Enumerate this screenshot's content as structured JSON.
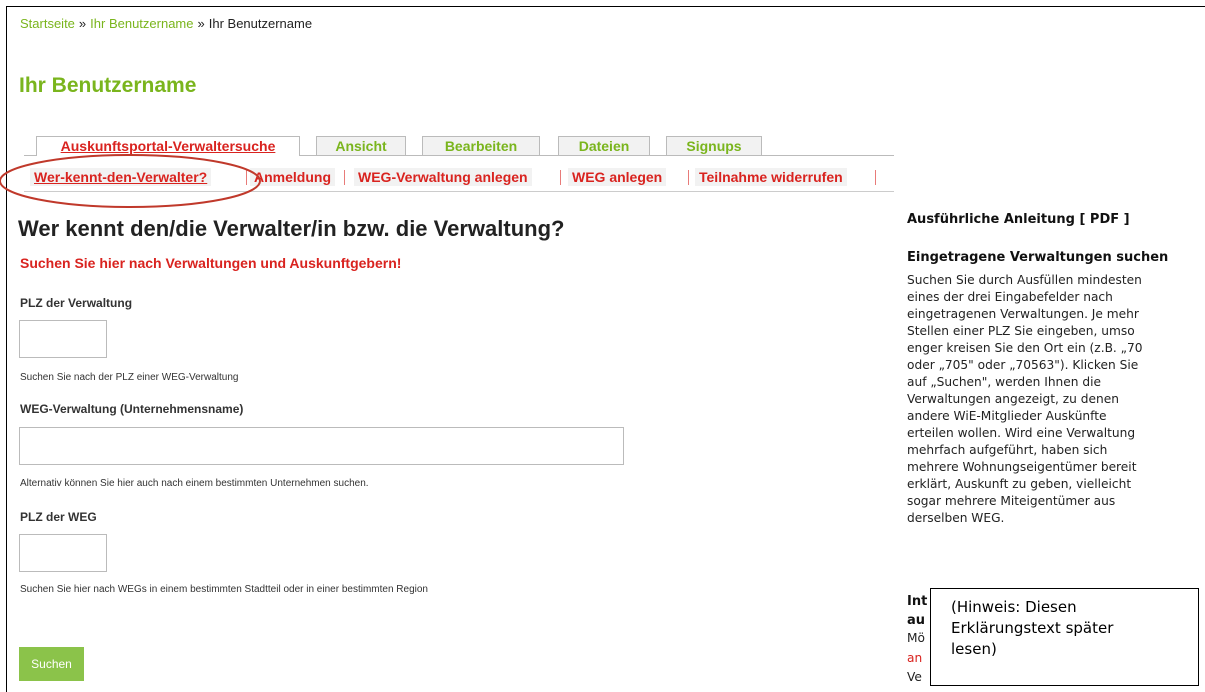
{
  "breadcrumb": {
    "home": "Startseite",
    "sep1": "»",
    "user_link": "Ihr Benutzername",
    "sep2": "»",
    "current": "Ihr Benutzername"
  },
  "page_title": "Ihr Benutzername",
  "primary_tabs": [
    {
      "label": "Auskunftsportal-Verwaltersuche",
      "active": true
    },
    {
      "label": "Ansicht"
    },
    {
      "label": "Bearbeiten"
    },
    {
      "label": "Dateien"
    },
    {
      "label": "Signups"
    }
  ],
  "secondary_tabs": [
    {
      "label": "Wer-kennt-den-Verwalter?",
      "active": true
    },
    {
      "label": "Anmeldung"
    },
    {
      "label": "WEG-Verwaltung anlegen"
    },
    {
      "label": "WEG anlegen"
    },
    {
      "label": "Teilnahme widerrufen"
    }
  ],
  "form": {
    "heading": "Wer kennt den/die Verwalter/in bzw. die Verwaltung?",
    "subheading": "Suchen Sie hier nach Verwaltungen und Auskunftgebern!",
    "plz_label": "PLZ der Verwaltung",
    "plz_value": "",
    "plz_help": "Suchen Sie nach der PLZ einer WEG-Verwaltung",
    "company_label": "WEG-Verwaltung (Unternehmensname)",
    "company_value": "",
    "company_help": "Alternativ können Sie hier auch nach einem bestimmten Unternehmen suchen.",
    "weg_plz_label": "PLZ der WEG",
    "weg_plz_value": "",
    "weg_plz_help": "Suchen Sie hier nach WEGs in einem bestimmten Stadtteil oder in einer bestimmten Region",
    "search_label": "Suchen"
  },
  "sidebar": {
    "guide_link": "Ausführliche Anleitung [ PDF ]",
    "section_title": "Eingetragene Verwaltungen suchen",
    "lines": [
      "Suchen Sie durch Ausfüllen mindesten",
      "eines der drei Eingabefelder nach",
      "eingetragenen Verwaltungen. Je mehr",
      "Stellen einer PLZ Sie eingeben, umso",
      "enger kreisen Sie den Ort ein (z.B. „70",
      "oder „705\" oder „70563\"). Klicken Sie",
      "auf „Suchen\", werden Ihnen die",
      "Verwaltungen angezeigt, zu denen",
      "andere WiE-Mitglieder Auskünfte",
      "erteilen wollen. Wird eine Verwaltung",
      "mehrfach aufgeführt, haben sich",
      "mehrere Wohnungseigentümer bereit",
      "erklärt, Auskunft zu geben, vielleicht",
      "sogar mehrere Miteigentümer aus",
      "derselben WEG."
    ],
    "cut_head1": "Int",
    "cut_head2": "au",
    "cut_text1": "Mö",
    "cut_text2": "an",
    "cut_text3": "Ve"
  },
  "note": {
    "line1": "(Hinweis: Diesen",
    "line2": "Erklärungstext später",
    "line3": "lesen)"
  }
}
